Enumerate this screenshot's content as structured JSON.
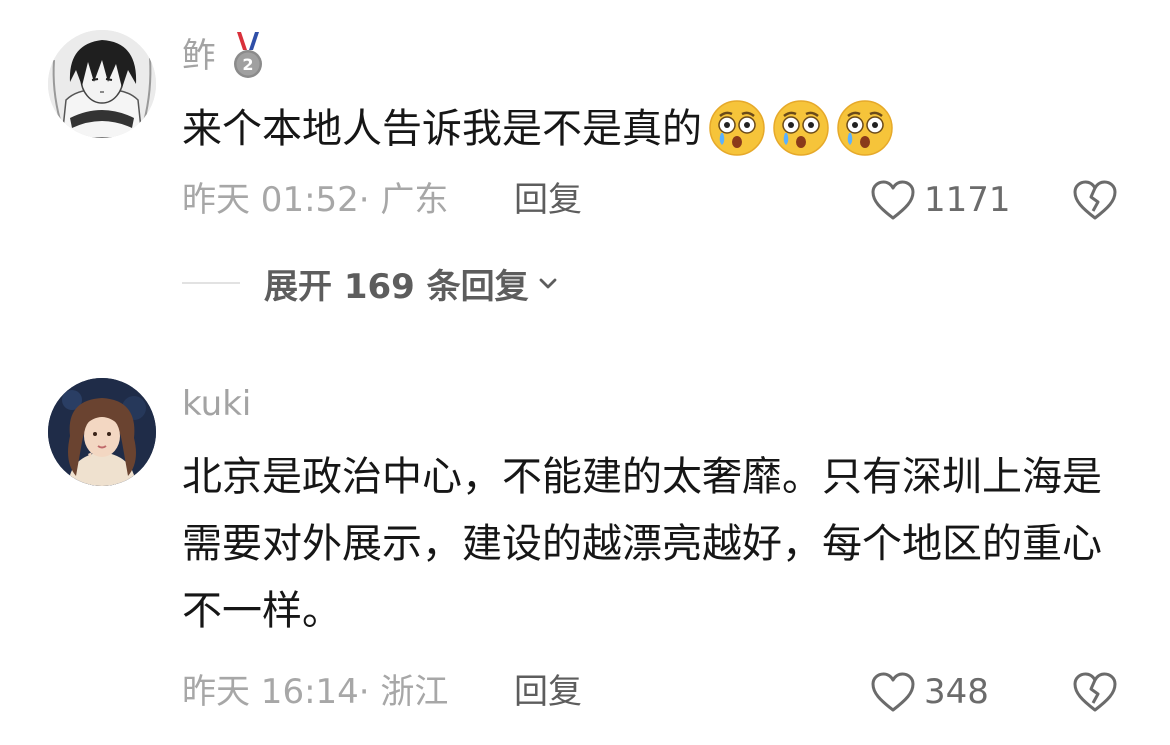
{
  "comments": [
    {
      "username": "鲊",
      "medal_number": "2",
      "text": "来个本地人告诉我是不是真的",
      "emojis": [
        "crying-shocked-emoji",
        "crying-shocked-emoji",
        "crying-shocked-emoji"
      ],
      "time": "昨天 01:52·",
      "location": "广东",
      "reply_label": "回复",
      "likes": "1171",
      "expand_replies": "展开 169 条回复"
    },
    {
      "username": "kuki",
      "text": "北京是政治中心，不能建的太奢靡。只有深圳上海是需要对外展示，建设的越漂亮越好，每个地区的重心不一样。",
      "time": "昨天 16:14·",
      "location": "浙江",
      "reply_label": "回复",
      "likes": "348"
    }
  ],
  "colors": {
    "text_primary": "#161616",
    "text_secondary": "#a7a7a7",
    "action_text": "#5d5d5d",
    "emoji_face": "#f6c43a",
    "medal_ribbon_red": "#d9313b",
    "medal_ribbon_blue": "#2f4fa8"
  },
  "icons": [
    "medal-icon",
    "avatar-image",
    "heart-icon",
    "broken-heart-icon",
    "chevron-down-icon"
  ]
}
